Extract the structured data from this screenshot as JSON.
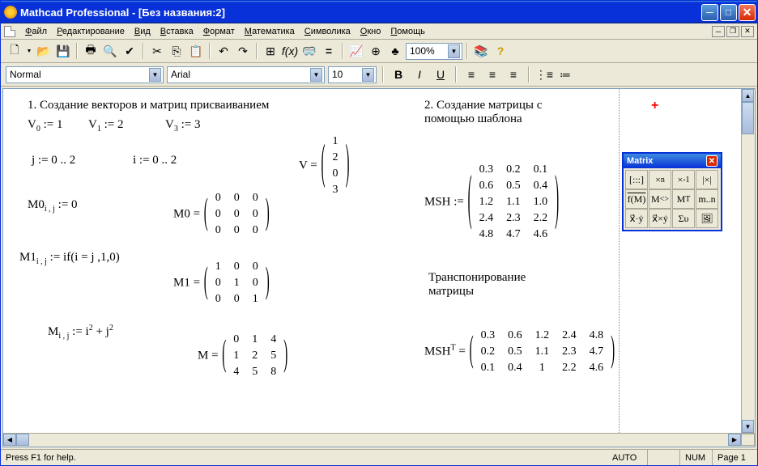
{
  "title": "Mathcad Professional - [Без названия:2]",
  "menu": [
    "Файл",
    "Редактирование",
    "Вид",
    "Вставка",
    "Формат",
    "Математика",
    "Символика",
    "Окно",
    "Помощь"
  ],
  "format": {
    "style": "Normal",
    "font": "Arial",
    "size": "10"
  },
  "zoom": "100%",
  "status": {
    "help": "Press F1 for help.",
    "auto": "AUTO",
    "num": "NUM",
    "page": "Page 1"
  },
  "text": {
    "heading1": "1. Создание векторов и матриц присваиванием",
    "heading2": "2. Создание матрицы с помощью шаблона",
    "transpose": "Транспонирование матрицы",
    "v0": "V",
    "v0idx": "0",
    "v0val": " := 1",
    "v1": "V",
    "v1idx": "1",
    "v1val": " := 2",
    "v3": "V",
    "v3idx": "3",
    "v3val": " := 3",
    "jrange": "j := 0 .. 2",
    "irange": "i := 0 .. 2",
    "m0def": "M0",
    "m0sub": "i , j",
    "m0val": " := 0",
    "m1def": "M1",
    "m1sub": "i , j",
    "m1val": " := if(i = j ,1,0)",
    "mdef": "M",
    "msub": "i , j"
  },
  "palette": {
    "title": "Matrix"
  },
  "matrices": {
    "V": [
      [
        "1"
      ],
      [
        "2"
      ],
      [
        "0"
      ],
      [
        "3"
      ]
    ],
    "M0": [
      [
        "0",
        "0",
        "0"
      ],
      [
        "0",
        "0",
        "0"
      ],
      [
        "0",
        "0",
        "0"
      ]
    ],
    "M1": [
      [
        "1",
        "0",
        "0"
      ],
      [
        "0",
        "1",
        "0"
      ],
      [
        "0",
        "0",
        "1"
      ]
    ],
    "M": [
      [
        "0",
        "1",
        "4"
      ],
      [
        "1",
        "2",
        "5"
      ],
      [
        "4",
        "5",
        "8"
      ]
    ],
    "MSH": [
      [
        "0.3",
        "0.2",
        "0.1"
      ],
      [
        "0.6",
        "0.5",
        "0.4"
      ],
      [
        "1.2",
        "1.1",
        "1.0"
      ],
      [
        "2.4",
        "2.3",
        "2.2"
      ],
      [
        "4.8",
        "4.7",
        "4.6"
      ]
    ],
    "MSHT": [
      [
        "0.3",
        "0.6",
        "1.2",
        "2.4",
        "4.8"
      ],
      [
        "0.2",
        "0.5",
        "1.1",
        "2.3",
        "4.7"
      ],
      [
        "0.1",
        "0.4",
        "1",
        "2.2",
        "4.6"
      ]
    ]
  }
}
